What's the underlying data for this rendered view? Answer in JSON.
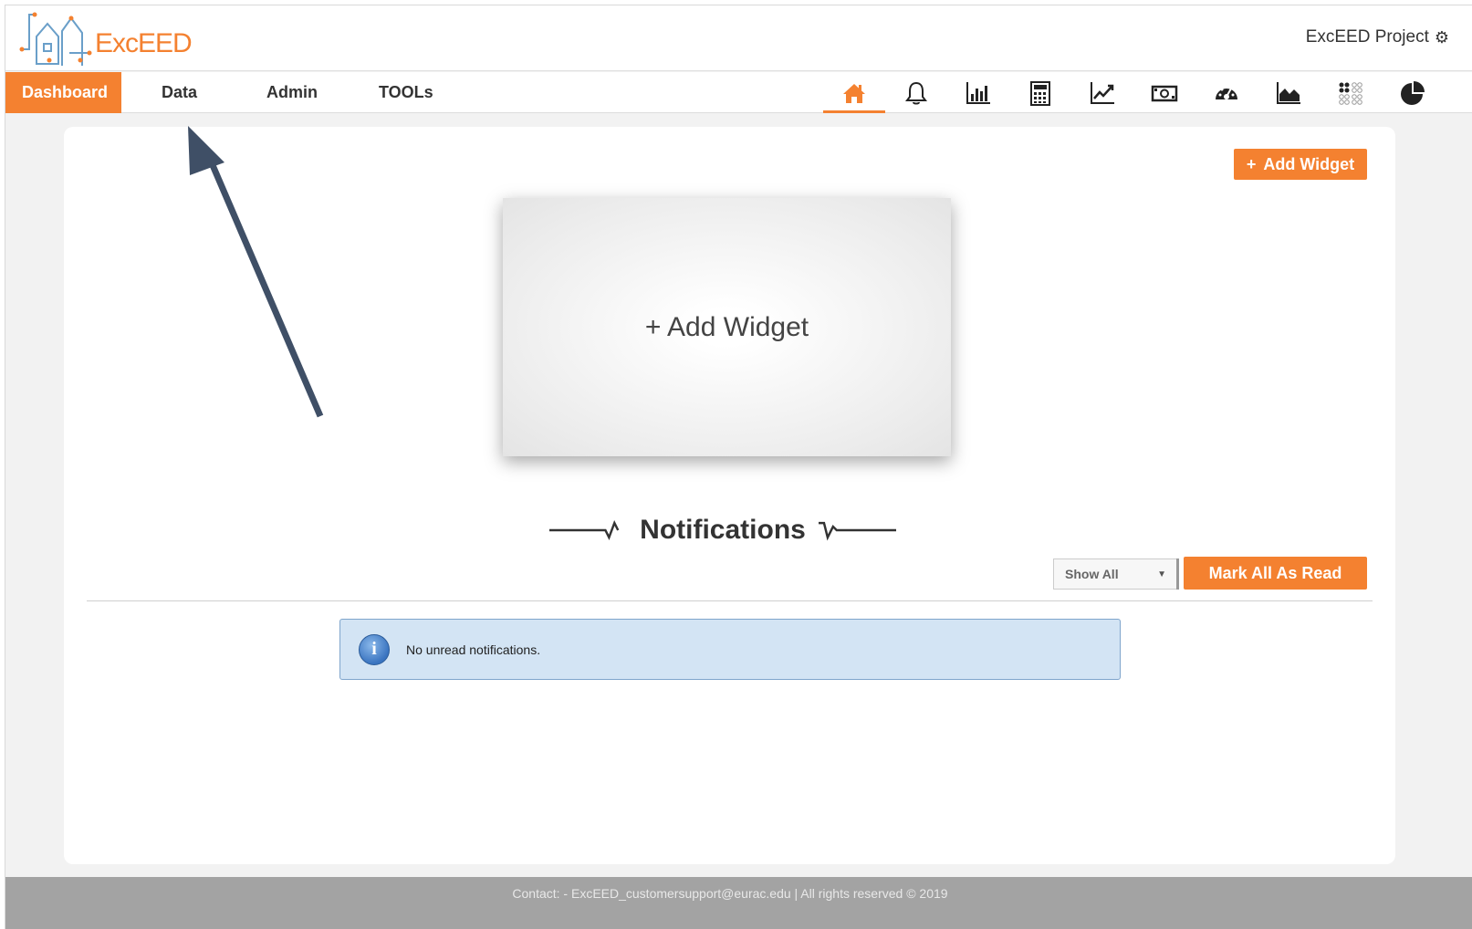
{
  "header": {
    "logo_text": "ExcEED",
    "project_label": "ExcEED Project"
  },
  "nav": {
    "items": [
      {
        "label": "Dashboard",
        "active": true
      },
      {
        "label": "Data"
      },
      {
        "label": "Admin"
      },
      {
        "label": "TOOLs"
      }
    ],
    "icons": [
      "home-icon",
      "bell-icon",
      "bar-chart-icon",
      "calculator-icon",
      "line-chart-icon",
      "money-icon",
      "dashboard-icon",
      "area-chart-icon",
      "dots-grid-icon",
      "pie-chart-icon"
    ]
  },
  "dashboard": {
    "add_widget_button": "Add Widget",
    "placeholder_text": "+ Add Widget"
  },
  "notifications": {
    "title": "Notifications",
    "filter_selected": "Show All",
    "mark_all_button": "Mark All As Read",
    "empty_message": "No unread notifications."
  },
  "footer": {
    "text": "Contact: - ExcEED_customersupport@eurac.edu | All rights reserved © 2019"
  },
  "colors": {
    "accent": "#f48130",
    "alert_bg": "#d3e4f4",
    "footer_bg": "#a3a3a3"
  }
}
